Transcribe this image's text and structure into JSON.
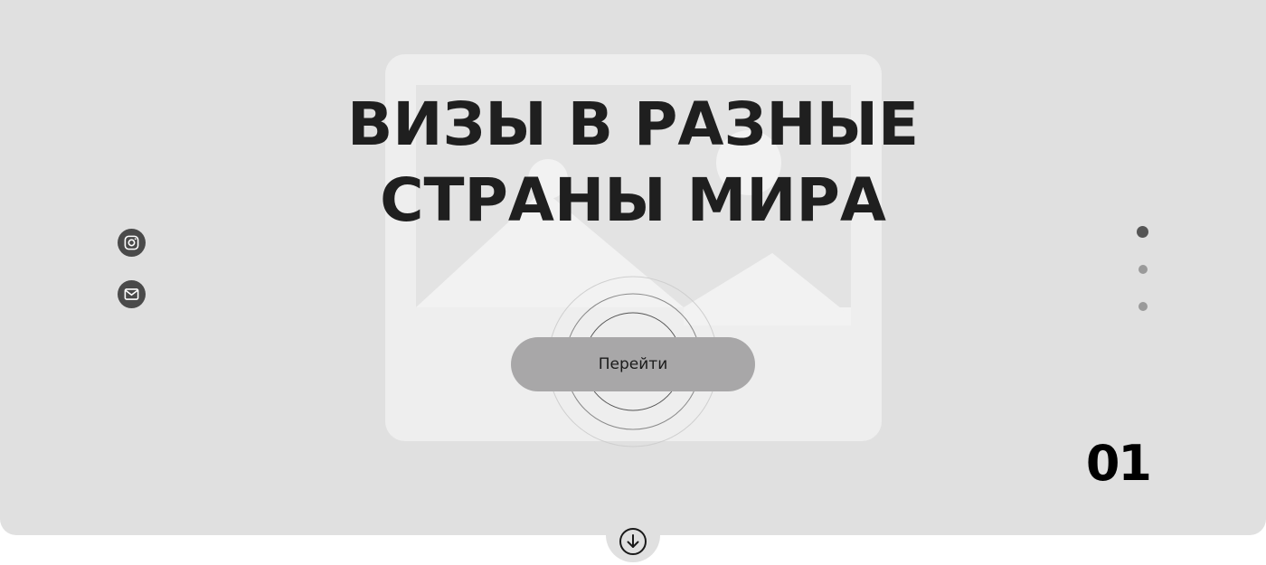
{
  "hero": {
    "title_line_1": "ВИЗЫ В РАЗНЫЕ",
    "title_line_2": "СТРАНЫ МИРА",
    "button_label": "Перейти",
    "slide_number": "01",
    "background_color": "#e0e0e0",
    "image": "image-placeholder-icon"
  },
  "social": {
    "items": [
      {
        "icon": "instagram-icon"
      },
      {
        "icon": "mail-icon"
      }
    ]
  },
  "pagination": {
    "total": 3,
    "active_index": 0,
    "active_color": "#555555",
    "inactive_color": "#9a9a9a"
  },
  "scroll": {
    "icon": "arrow-down-circle-icon"
  }
}
